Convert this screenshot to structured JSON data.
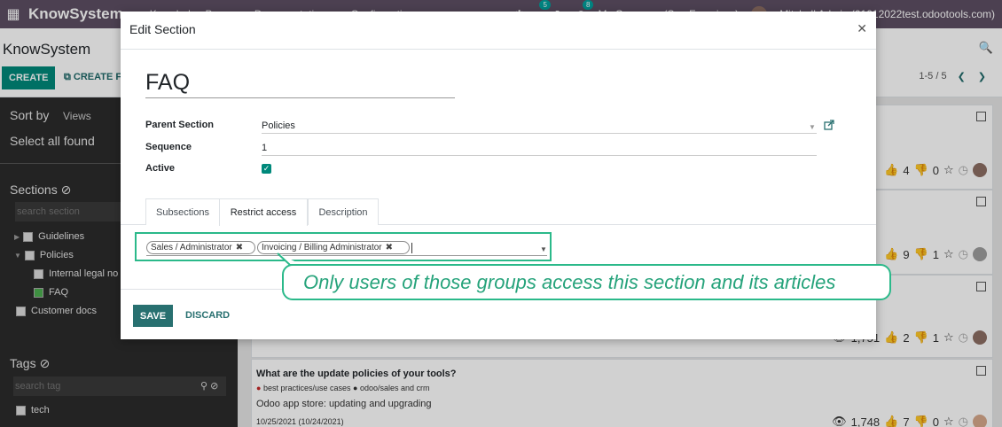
{
  "app": {
    "brand": "KnowSystem",
    "menu": [
      "Knowledge Base",
      "Documentation",
      "Configuration"
    ],
    "notif_counts": [
      "5",
      "8"
    ],
    "company": "My Company (San Francisco)",
    "user": "Mitchell Admin (01012022test.odootools.com)"
  },
  "control": {
    "breadcrumb": "KnowSystem",
    "create_label": "CREATE",
    "create2_label": "CREATE F",
    "pager": "1-5 / 5"
  },
  "sidebar": {
    "sort_label": "Sort by",
    "views_label": "Views",
    "select_all": "Select all found",
    "sections_title": "Sections",
    "search_section_placeholder": "search section",
    "sections": [
      {
        "label": "Guidelines",
        "checked": false
      },
      {
        "label": "Policies",
        "checked": false
      },
      {
        "label": "Internal legal no",
        "checked": false
      },
      {
        "label": "FAQ",
        "checked": true
      },
      {
        "label": "Customer docs",
        "checked": false
      }
    ],
    "tags_title": "Tags",
    "search_tag_placeholder": "search tag",
    "tags": [
      {
        "label": "tech"
      }
    ]
  },
  "cards": [
    {
      "likes": "4",
      "dislikes": "0"
    },
    {
      "likes": "9",
      "dislikes": "1"
    },
    {
      "views": "1,751",
      "likes": "2",
      "dislikes": "1"
    },
    {
      "title": "What are the update policies of your tools?",
      "tag1": "best practices/use cases",
      "tag2": "odoo/sales and crm",
      "desc": "Odoo app store: updating and upgrading",
      "date": "10/25/2021 (10/24/2021)",
      "views": "1,748",
      "likes": "7",
      "dislikes": "0"
    }
  ],
  "modal": {
    "title": "Edit Section",
    "name": "FAQ",
    "fields": {
      "parent_label": "Parent Section",
      "parent_value": "Policies",
      "sequence_label": "Sequence",
      "sequence_value": "1",
      "active_label": "Active",
      "active_checked": true
    },
    "tabs": [
      "Subsections",
      "Restrict access",
      "Description"
    ],
    "active_tab": "Restrict access",
    "groups": [
      "Sales / Administrator",
      "Invoicing / Billing Administrator"
    ],
    "save_label": "SAVE",
    "discard_label": "DISCARD"
  },
  "callout": {
    "text": "Only users of those groups access this section and its articles"
  },
  "colors": {
    "primary": "#287070",
    "accent": "#2bb98a",
    "topbar": "#5d4f63"
  }
}
